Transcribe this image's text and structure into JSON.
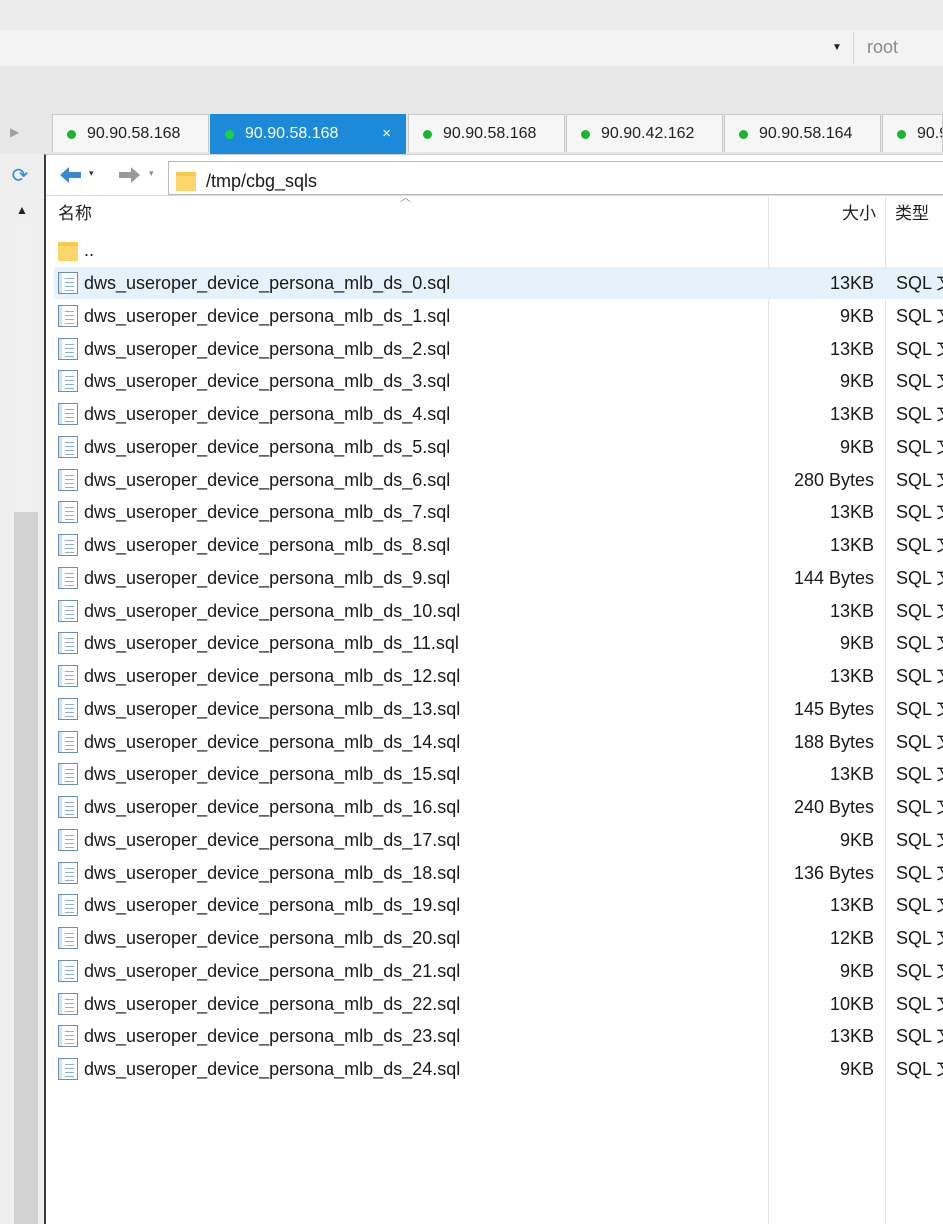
{
  "header": {
    "user_name": "root",
    "dropdown_glyph": "▼"
  },
  "tabs": [
    {
      "label": "90.90.58.168",
      "status_color": "#19b52f",
      "active": false
    },
    {
      "label": "90.90.58.168",
      "status_color": "#1ad43d",
      "active": true,
      "close_glyph": "×"
    },
    {
      "label": "90.90.58.168",
      "status_color": "#19b52f",
      "active": false
    },
    {
      "label": "90.90.42.162",
      "status_color": "#19b52f",
      "active": false
    },
    {
      "label": "90.90.58.164",
      "status_color": "#19b52f",
      "active": false
    },
    {
      "label": "90.9",
      "status_color": "#19b52f",
      "active": false
    }
  ],
  "tree": {
    "refresh_icon": "refresh-icon",
    "up_glyph": "▲"
  },
  "nav": {
    "back_glyph": "🡐",
    "forward_glyph": "🡒",
    "dropdown_glyph": "▾",
    "path": "/tmp/cbg_sqls"
  },
  "columns": {
    "name": "名称",
    "size": "大小",
    "type": "类型"
  },
  "parent_folder": {
    "name": ".."
  },
  "files": [
    {
      "name": "dws_useroper_device_persona_mlb_ds_0.sql",
      "size": "13KB",
      "type": "SQL 文",
      "selected": true
    },
    {
      "name": "dws_useroper_device_persona_mlb_ds_1.sql",
      "size": "9KB",
      "type": "SQL 文"
    },
    {
      "name": "dws_useroper_device_persona_mlb_ds_2.sql",
      "size": "13KB",
      "type": "SQL 文"
    },
    {
      "name": "dws_useroper_device_persona_mlb_ds_3.sql",
      "size": "9KB",
      "type": "SQL 文"
    },
    {
      "name": "dws_useroper_device_persona_mlb_ds_4.sql",
      "size": "13KB",
      "type": "SQL 文"
    },
    {
      "name": "dws_useroper_device_persona_mlb_ds_5.sql",
      "size": "9KB",
      "type": "SQL 文"
    },
    {
      "name": "dws_useroper_device_persona_mlb_ds_6.sql",
      "size": "280 Bytes",
      "type": "SQL 文"
    },
    {
      "name": "dws_useroper_device_persona_mlb_ds_7.sql",
      "size": "13KB",
      "type": "SQL 文"
    },
    {
      "name": "dws_useroper_device_persona_mlb_ds_8.sql",
      "size": "13KB",
      "type": "SQL 文"
    },
    {
      "name": "dws_useroper_device_persona_mlb_ds_9.sql",
      "size": "144 Bytes",
      "type": "SQL 文"
    },
    {
      "name": "dws_useroper_device_persona_mlb_ds_10.sql",
      "size": "13KB",
      "type": "SQL 文"
    },
    {
      "name": "dws_useroper_device_persona_mlb_ds_11.sql",
      "size": "9KB",
      "type": "SQL 文"
    },
    {
      "name": "dws_useroper_device_persona_mlb_ds_12.sql",
      "size": "13KB",
      "type": "SQL 文"
    },
    {
      "name": "dws_useroper_device_persona_mlb_ds_13.sql",
      "size": "145 Bytes",
      "type": "SQL 文"
    },
    {
      "name": "dws_useroper_device_persona_mlb_ds_14.sql",
      "size": "188 Bytes",
      "type": "SQL 文"
    },
    {
      "name": "dws_useroper_device_persona_mlb_ds_15.sql",
      "size": "13KB",
      "type": "SQL 文"
    },
    {
      "name": "dws_useroper_device_persona_mlb_ds_16.sql",
      "size": "240 Bytes",
      "type": "SQL 文"
    },
    {
      "name": "dws_useroper_device_persona_mlb_ds_17.sql",
      "size": "9KB",
      "type": "SQL 文"
    },
    {
      "name": "dws_useroper_device_persona_mlb_ds_18.sql",
      "size": "136 Bytes",
      "type": "SQL 文"
    },
    {
      "name": "dws_useroper_device_persona_mlb_ds_19.sql",
      "size": "13KB",
      "type": "SQL 文"
    },
    {
      "name": "dws_useroper_device_persona_mlb_ds_20.sql",
      "size": "12KB",
      "type": "SQL 文"
    },
    {
      "name": "dws_useroper_device_persona_mlb_ds_21.sql",
      "size": "9KB",
      "type": "SQL 文"
    },
    {
      "name": "dws_useroper_device_persona_mlb_ds_22.sql",
      "size": "10KB",
      "type": "SQL 文"
    },
    {
      "name": "dws_useroper_device_persona_mlb_ds_23.sql",
      "size": "13KB",
      "type": "SQL 文"
    },
    {
      "name": "dws_useroper_device_persona_mlb_ds_24.sql",
      "size": "9KB",
      "type": "SQL 文"
    }
  ],
  "colors": {
    "accent": "#1c8ad8",
    "selection": "#e5f1fb",
    "online": "#19b52f"
  }
}
